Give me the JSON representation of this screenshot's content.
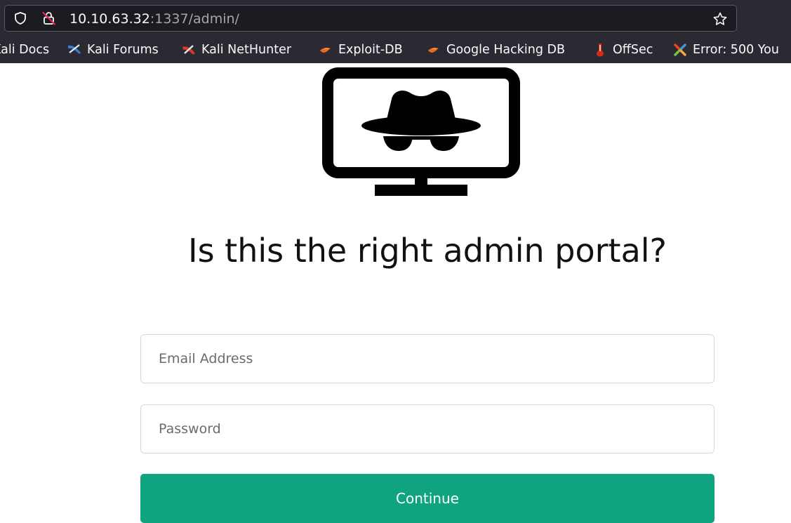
{
  "browser": {
    "url_host": "10.10.63.32",
    "url_path": ":1337/admin/",
    "icons": {
      "left": [
        "shield-icon",
        "lock-icon"
      ],
      "right": "star-icon"
    },
    "bookmarks": [
      {
        "label": "Kali Docs",
        "icon": "kali-docs-icon"
      },
      {
        "label": "Kali Forums",
        "icon": "kali-forums-icon"
      },
      {
        "label": "Kali NetHunter",
        "icon": "kali-nethunter-icon"
      },
      {
        "label": "Exploit-DB",
        "icon": "exploit-db-icon"
      },
      {
        "label": "Google Hacking DB",
        "icon": "ghdb-icon"
      },
      {
        "label": "OffSec",
        "icon": "offsec-icon"
      },
      {
        "label": "Error: 500 You",
        "icon": "joomla-icon"
      }
    ]
  },
  "page": {
    "logo_icon": "spy-monitor-icon",
    "title": "Is this the right admin portal?",
    "email_placeholder": "Email Address",
    "password_placeholder": "Password",
    "continue_label": "Continue"
  },
  "colors": {
    "chrome_bg": "#2b2a33",
    "urlbar_bg": "#1c1b22",
    "button_bg": "#10a37f",
    "button_text": "#ffffff",
    "title_text": "#111111"
  }
}
